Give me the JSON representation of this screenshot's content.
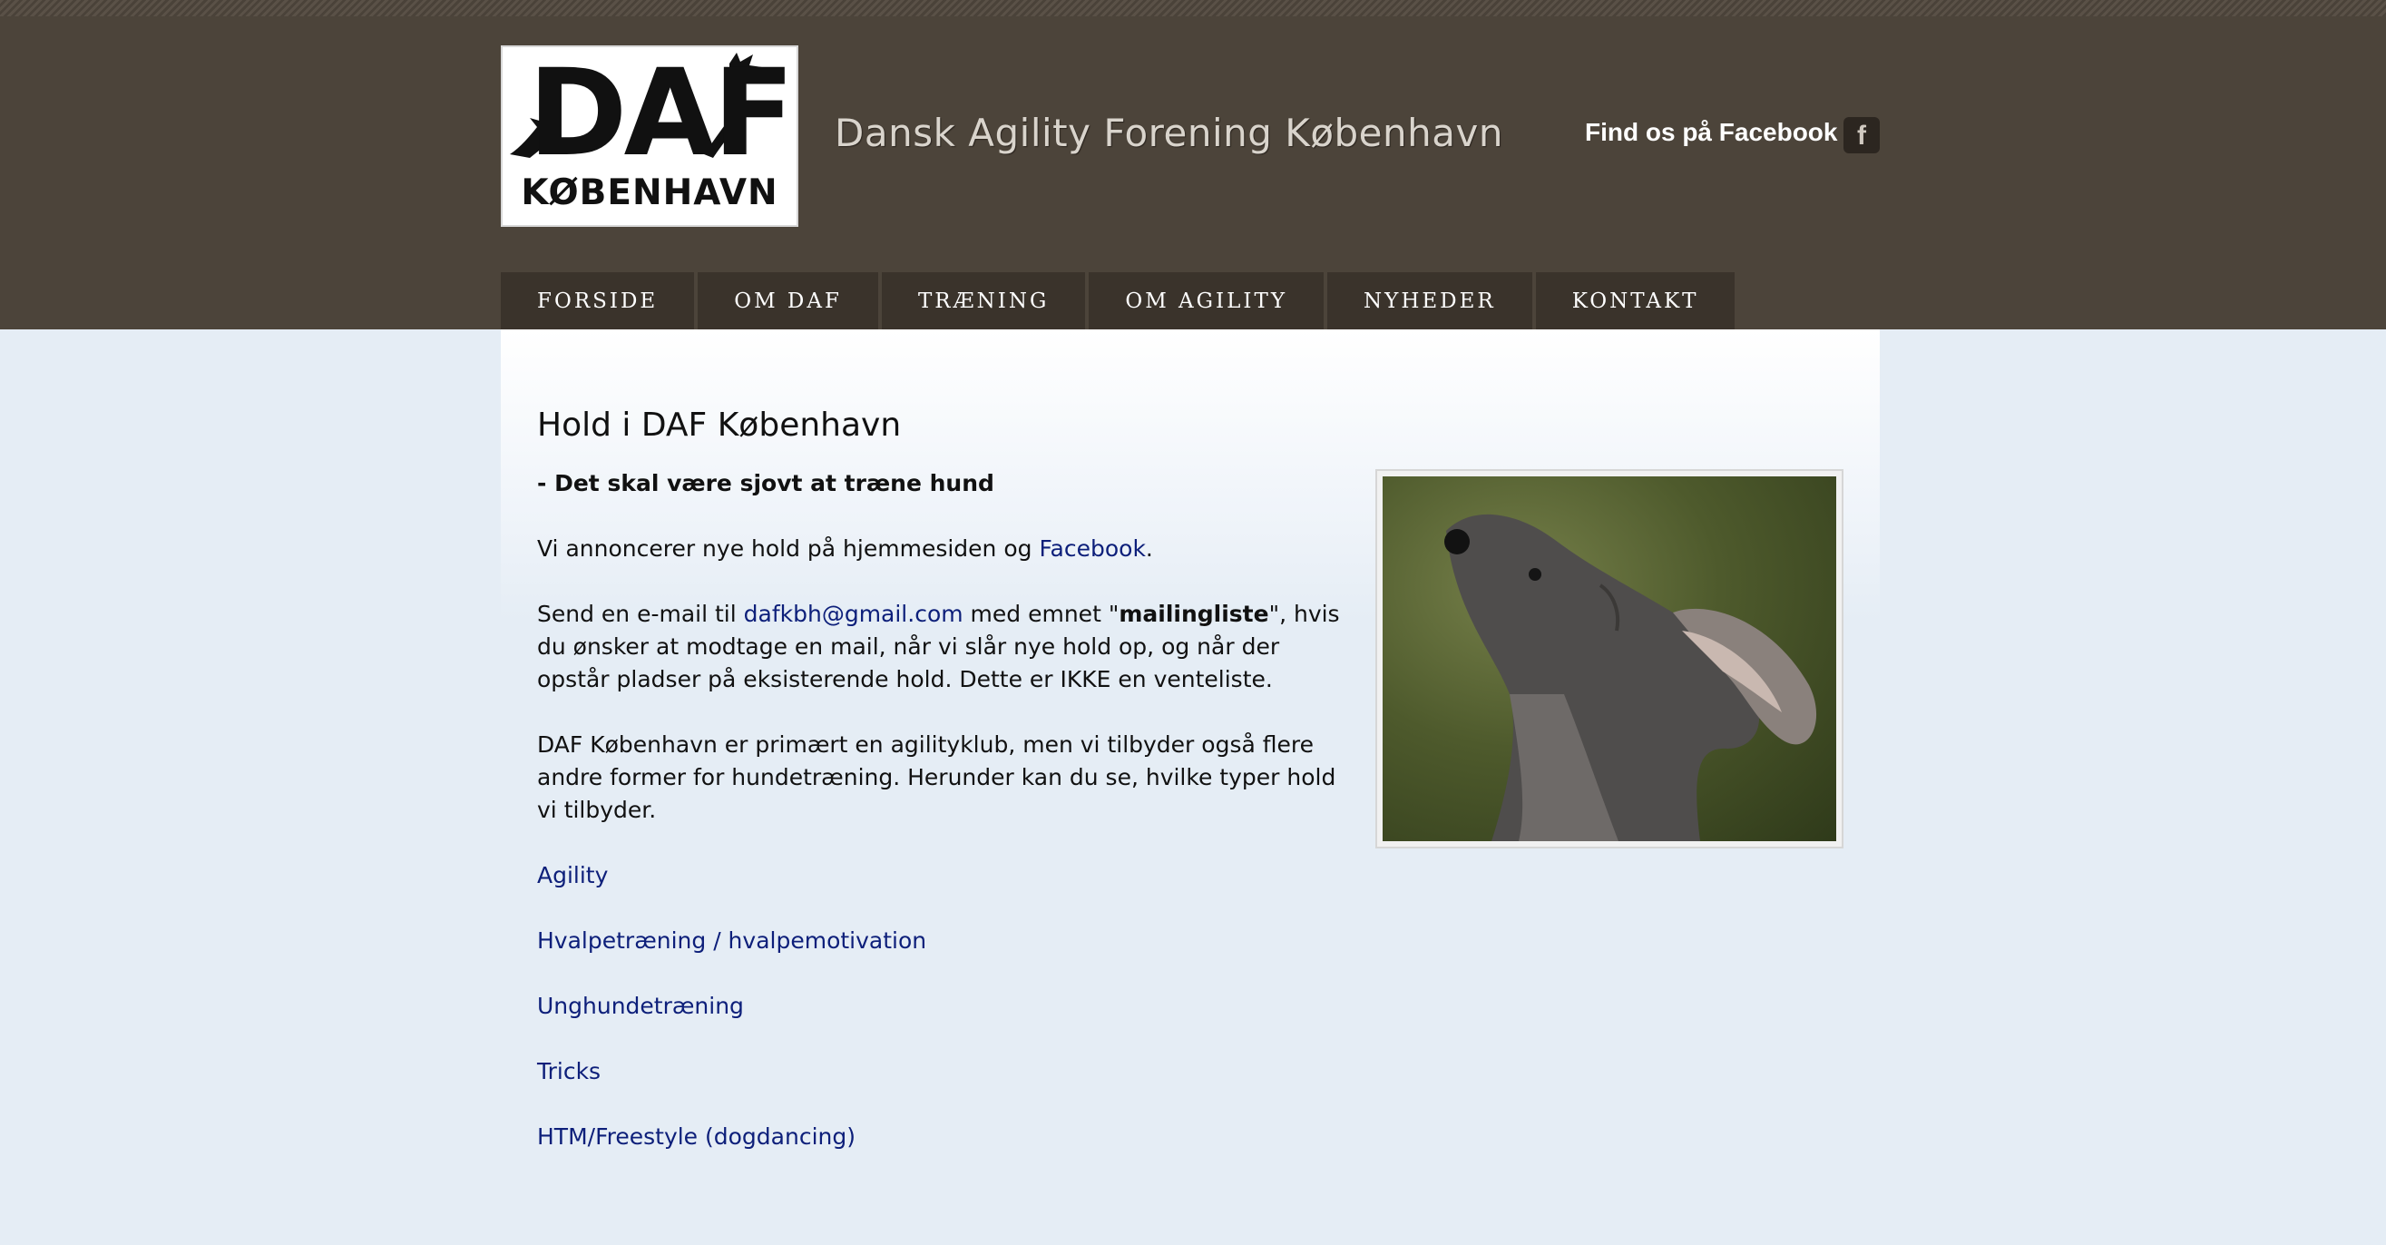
{
  "header": {
    "logo": {
      "word": "DAF",
      "city": "KØBENHAVN"
    },
    "site_title": "Dansk Agility Forening København",
    "facebook_label": "Find os på Facebook",
    "facebook_icon": "facebook-icon"
  },
  "nav": {
    "items": [
      {
        "label": "FORSIDE"
      },
      {
        "label": "OM DAF"
      },
      {
        "label": "TRÆNING"
      },
      {
        "label": "OM AGILITY"
      },
      {
        "label": "NYHEDER"
      },
      {
        "label": "KONTAKT"
      }
    ]
  },
  "main": {
    "title": "Hold i DAF København",
    "subtitle": "- Det skal være sjovt at træne hund",
    "p1": {
      "before": "Vi annoncerer nye hold på hjemmesiden og ",
      "link": "Facebook",
      "after": "."
    },
    "p2": {
      "before": "Send en e-mail til ",
      "email": "dafkbh@gmail.com",
      "middle": " med emnet \"",
      "bold": "mailingliste",
      "after": "\", hvis du ønsker at modtage en mail, når vi slår nye hold op, og når der opstår pladser på eksisterende hold. Dette er IKKE en venteliste."
    },
    "p3": "DAF København er primært en agilityklub, men vi tilbyder også flere andre former for hundetræning. Herunder kan du se, hvilke typer hold vi tilbyder.",
    "links": [
      {
        "label": "Agility"
      },
      {
        "label": "Hvalpetræning / hvalpemotivation"
      },
      {
        "label": "Unghundetræning"
      },
      {
        "label": "Tricks"
      },
      {
        "label": "HTM/Freestyle (dogdancing)"
      }
    ]
  },
  "colors": {
    "header_bg": "#4c443a",
    "nav_bg": "#3a332b",
    "page_bg": "#e5edf5",
    "link": "#0d1f7a"
  }
}
